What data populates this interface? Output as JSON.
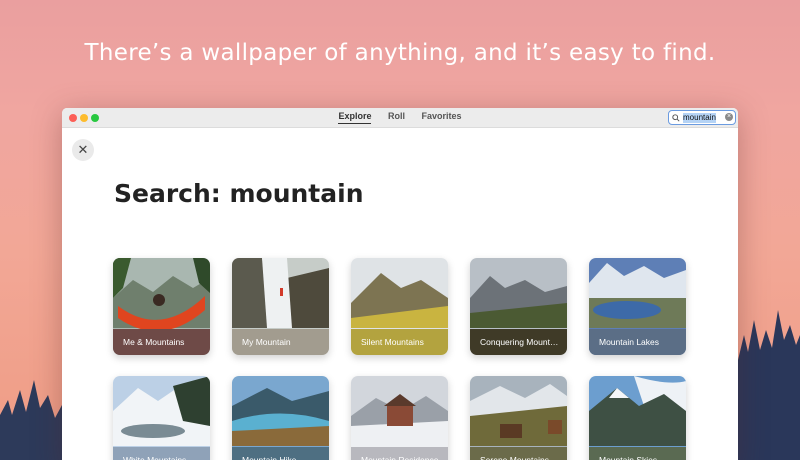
{
  "headline": "There’s a wallpaper of anything, and it’s easy to find.",
  "window": {
    "tabs": [
      {
        "label": "Explore",
        "active": true
      },
      {
        "label": "Roll",
        "active": false
      },
      {
        "label": "Favorites",
        "active": false
      }
    ],
    "search": {
      "value": "mountain"
    },
    "close_glyph": "✕",
    "page_title": "Search: mountain"
  },
  "results": [
    {
      "label": "Me & Mountains",
      "label_color": "#6e4a47"
    },
    {
      "label": "My Mountain",
      "label_color": "#a29c8f"
    },
    {
      "label": "Silent Mountains",
      "label_color": "#b3a33f"
    },
    {
      "label": "Conquering Mount…",
      "label_color": "#3f3a27"
    },
    {
      "label": "Mountain Lakes",
      "label_color": "#5b6e86"
    },
    {
      "label": "White Mountains",
      "label_color": "#8fa2b8"
    },
    {
      "label": "Mountain Hike",
      "label_color": "#4e6f82"
    },
    {
      "label": "Mountain Residence",
      "label_color": "#b8b8be"
    },
    {
      "label": "Serene Mountains",
      "label_color": "#6b6b4a"
    },
    {
      "label": "Mountain Skies",
      "label_color": "#5a6a52"
    }
  ],
  "icons": {
    "close": "close-icon",
    "search": "search-icon",
    "clear": "clear-search-icon"
  },
  "colors": {
    "background_gradient_top": "#ea9f9f",
    "background_gradient_bottom": "#ef9c84",
    "search_focus": "#6b9be0"
  }
}
